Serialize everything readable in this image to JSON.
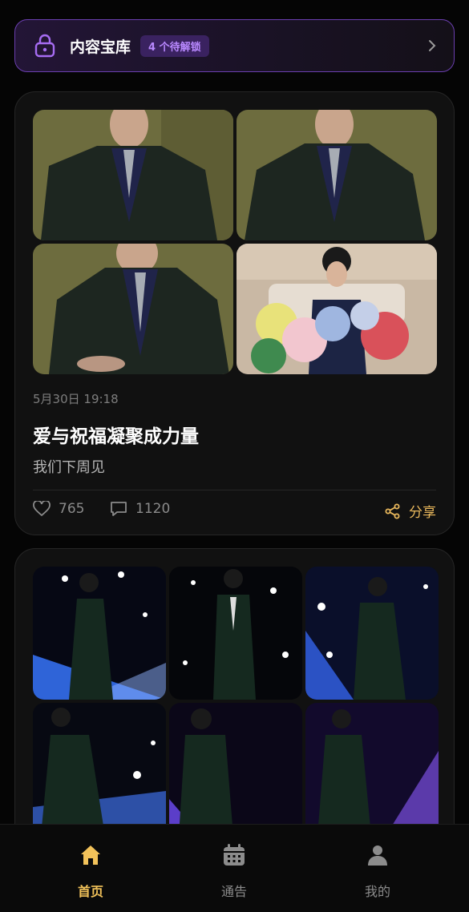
{
  "vault": {
    "title": "内容宝库",
    "badge": "4 个待解锁",
    "accent": "#6b3fb0",
    "badge_color": "#b989ff",
    "lock_icon": "lock-icon",
    "chevron_icon": "chevron-right-icon"
  },
  "post1": {
    "date": "5月30日 19:18",
    "title": "爱与祝福凝聚成力量",
    "subtitle": "我们下周见",
    "likes": "765",
    "comments": "1120",
    "share_label": "分享",
    "photo_count": 4
  },
  "post2": {
    "photo_count": 6
  },
  "tabbar": {
    "items": [
      {
        "label": "首页",
        "icon": "home-icon",
        "active": true
      },
      {
        "label": "通告",
        "icon": "calendar-icon",
        "active": false
      },
      {
        "label": "我的",
        "icon": "user-icon",
        "active": false
      }
    ],
    "active_color": "#f2c25a"
  }
}
